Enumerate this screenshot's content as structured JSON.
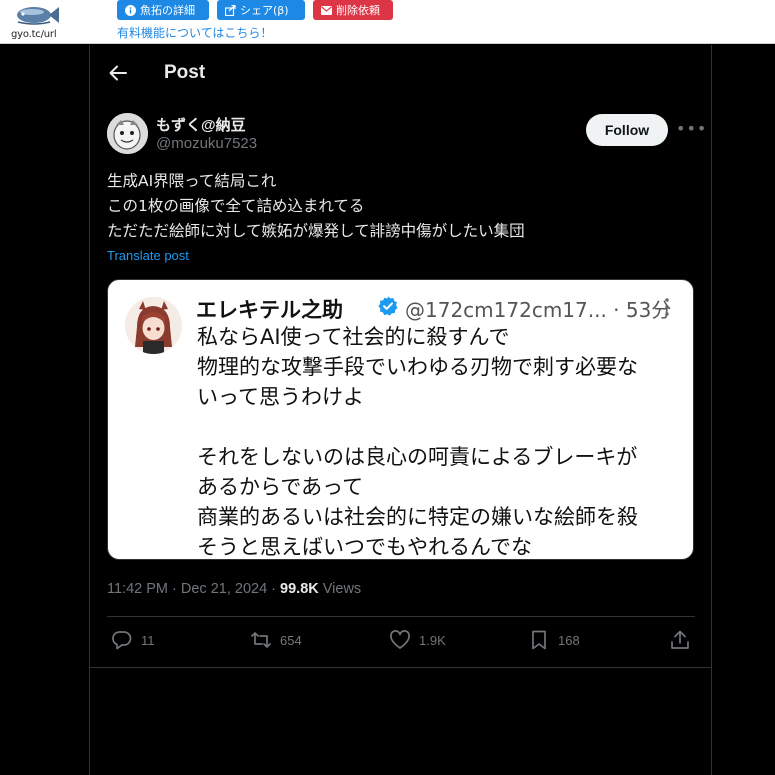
{
  "banner": {
    "logo_text": "gyo.tc/url",
    "buttons": [
      {
        "label": "魚拓の詳細",
        "icon": "info-icon",
        "color": "#1e88e5"
      },
      {
        "label": "シェア(β)",
        "icon": "share-icon",
        "color": "#1e88e5"
      },
      {
        "label": "削除依頼",
        "icon": "mail-icon",
        "color": "#dc3545"
      }
    ],
    "paid_link": "有料機能についてはこちら！"
  },
  "header": {
    "title": "Post"
  },
  "post": {
    "display_name": "もずく@納豆",
    "handle": "@mozuku7523",
    "follow_label": "Follow",
    "lines": [
      "生成AI界隈って結局これ",
      "この1枚の画像で全て詰め込まれてる",
      "ただただ絵師に対して嫉妬が爆発して誹謗中傷がしたい集団"
    ],
    "translate_label": "Translate post",
    "embed": {
      "name": "エレキテル之助",
      "handle_time": "@172cm172cm17... · 53分",
      "lines": [
        "私ならAI使って社会的に殺すんで",
        "物理的な攻撃手段でいわゆる刃物で刺す必要な",
        "いって思うわけよ",
        "",
        "それをしないのは良心の呵責によるブレーキが",
        "あるからであって",
        "商業的あるいは社会的に特定の嫌いな絵師を殺",
        "そうと思えばいつでもやれるんでな"
      ]
    },
    "timestamp": "11:42 PM · Dec 21, 2024 · ",
    "views_count": "99.8K",
    "views_label": " Views",
    "actions": {
      "replies": "11",
      "reposts": "654",
      "likes": "1.9K",
      "bookmarks": "168"
    }
  },
  "colors": {
    "accent": "#1d9bf0",
    "text": "#e7e9ea",
    "muted": "#71767b",
    "background": "#000000"
  }
}
